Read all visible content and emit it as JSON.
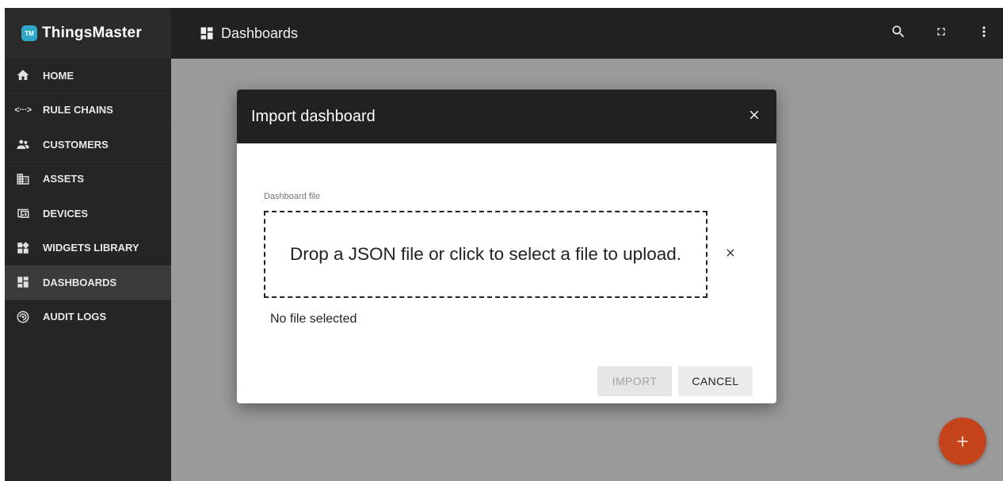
{
  "brand": {
    "logo_text": "TM",
    "name": "ThingsMaster"
  },
  "sidebar": {
    "items": [
      {
        "label": "HOME",
        "icon": "home-icon",
        "active": false
      },
      {
        "label": "RULE CHAINS",
        "icon": "rule-chains-icon",
        "active": false
      },
      {
        "label": "CUSTOMERS",
        "icon": "customers-icon",
        "active": false
      },
      {
        "label": "ASSETS",
        "icon": "assets-icon",
        "active": false
      },
      {
        "label": "DEVICES",
        "icon": "devices-icon",
        "active": false
      },
      {
        "label": "WIDGETS LIBRARY",
        "icon": "widgets-library-icon",
        "active": false
      },
      {
        "label": "DASHBOARDS",
        "icon": "dashboards-icon",
        "active": true
      },
      {
        "label": "AUDIT LOGS",
        "icon": "audit-logs-icon",
        "active": false
      }
    ]
  },
  "topbar": {
    "title": "Dashboards",
    "actions": [
      "search-icon",
      "fullscreen-icon",
      "more-vert-icon"
    ]
  },
  "dialog": {
    "title": "Import dashboard",
    "field_label": "Dashboard file",
    "dropzone_text": "Drop a JSON file or click to select a file to upload.",
    "file_status": "No file selected",
    "import_label": "IMPORT",
    "cancel_label": "CANCEL"
  },
  "fab": {
    "label": "+"
  },
  "colors": {
    "sidebar_bg": "#252525",
    "topbar_bg": "#212121",
    "backdrop": "#9a9a9a",
    "fab": "#c5431b",
    "brand_logo": "#2fa7c9"
  }
}
